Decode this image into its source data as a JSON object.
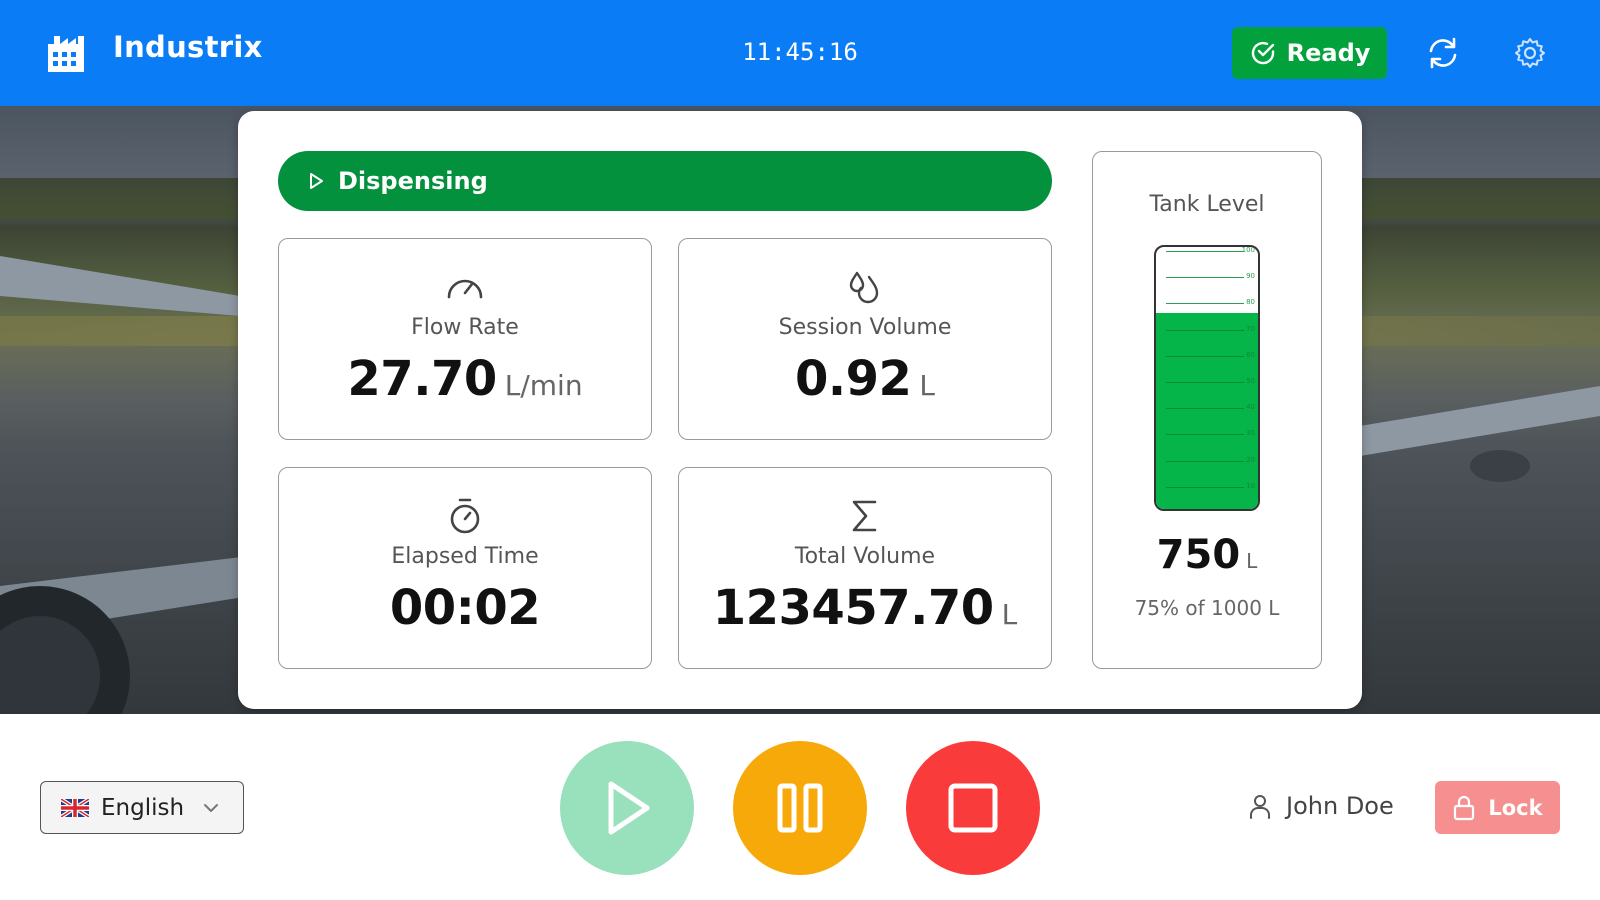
{
  "header": {
    "brand": "Industrix",
    "clock": "11:45:16",
    "ready_label": "Ready",
    "icons": [
      "factory-icon",
      "check-circle-icon",
      "refresh-icon",
      "gear-icon"
    ]
  },
  "status": {
    "label": "Dispensing",
    "color": "#04913d"
  },
  "metrics": [
    {
      "label": "Flow Rate",
      "value": "27.70",
      "unit": "L/min",
      "icon": "gauge-icon"
    },
    {
      "label": "Session Volume",
      "value": "0.92",
      "unit": "L",
      "icon": "droplets-icon"
    },
    {
      "label": "Elapsed Time",
      "value": "00:02",
      "unit": "",
      "icon": "timer-icon"
    },
    {
      "label": "Total Volume",
      "value": "123457.70",
      "unit": "L",
      "icon": "sigma-icon"
    }
  ],
  "tank": {
    "title": "Tank Level",
    "value": "750",
    "unit": "L",
    "caption": "75% of 1000 L",
    "fill_fraction": 0.75,
    "scale_labels": [
      "100",
      "90",
      "80",
      "70",
      "60",
      "50",
      "40",
      "30",
      "20",
      "10"
    ]
  },
  "footer": {
    "language": "English",
    "user": "John Doe",
    "lock_label": "Lock"
  },
  "colors": {
    "header": "#0a7cf5",
    "ready": "#03a13c",
    "play": "#99e0bd",
    "pause": "#f7a90a",
    "stop": "#fa3b3b",
    "lock": "#f68f8f",
    "tank_fill": "#06b54a"
  }
}
